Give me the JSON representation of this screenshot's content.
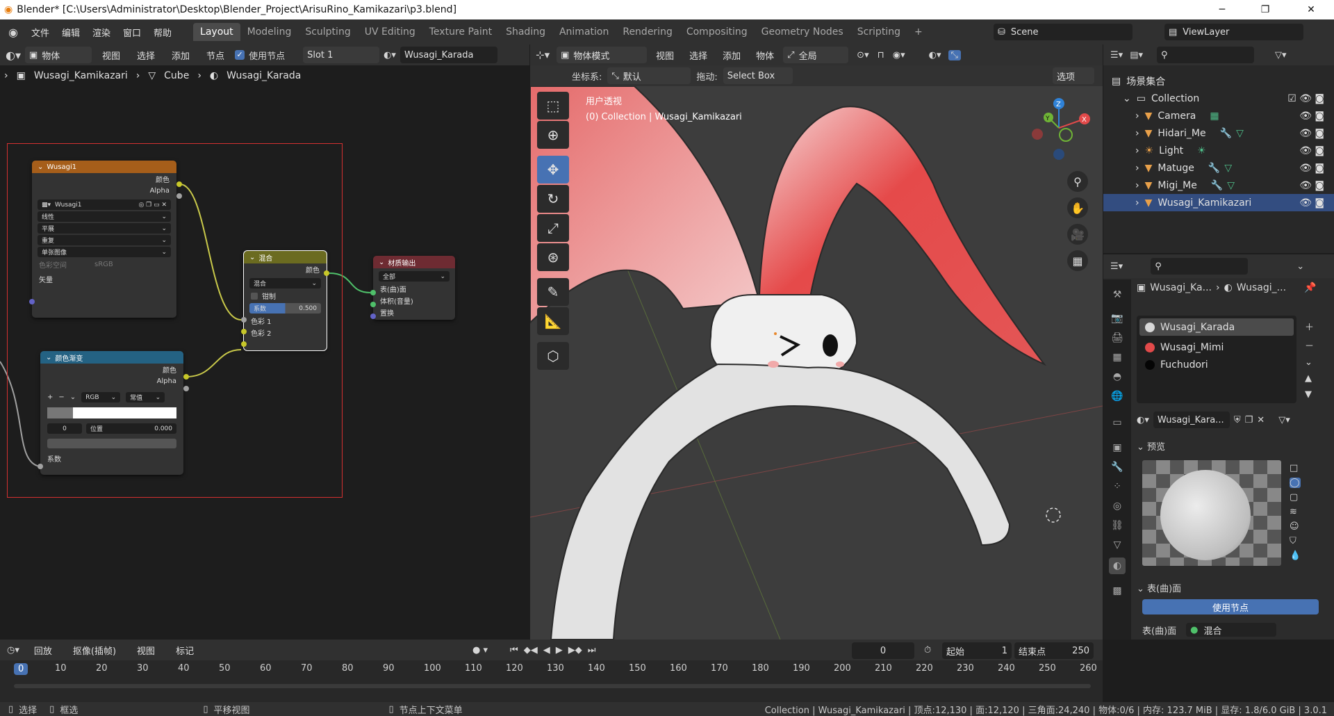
{
  "titlebar": {
    "title": "Blender* [C:\\Users\\Administrator\\Desktop\\Blender_Project\\ArisuRino_Kamikazari\\p3.blend]",
    "minimize": "─",
    "maximize": "❐",
    "close": "✕"
  },
  "menu": {
    "items": [
      "文件",
      "编辑",
      "渲染",
      "窗口",
      "帮助"
    ],
    "workspaces": [
      "Layout",
      "Modeling",
      "Sculpting",
      "UV Editing",
      "Texture Paint",
      "Shading",
      "Animation",
      "Rendering",
      "Compositing",
      "Geometry Nodes",
      "Scripting",
      "+"
    ],
    "active_workspace": "Layout",
    "scene": "Scene",
    "view_layer": "ViewLayer"
  },
  "node_editor": {
    "header": {
      "object": "物体",
      "view": "视图",
      "select": "选择",
      "add": "添加",
      "node": "节点",
      "use_nodes": "使用节点",
      "slot": "Slot 1",
      "material": "Wusagi_Karada"
    },
    "breadcrumb": [
      "Wusagi_Kamikazari",
      "Cube",
      "Wusagi_Karada"
    ],
    "nodes": {
      "image": {
        "title": "Wusagi1",
        "out_color": "颜色",
        "out_alpha": "Alpha",
        "image_name": "Wusagi1",
        "interp": "线性",
        "proj": "平展",
        "ext": "重复",
        "source": "单张图像",
        "colorspace_label": "色彩空间",
        "colorspace_value": "sRGB",
        "in_vector": "矢量"
      },
      "ramp": {
        "title": "颜色渐变",
        "out_color": "颜色",
        "out_alpha": "Alpha",
        "mode": "RGB",
        "interp": "常值",
        "index": "0",
        "pos_label": "位置",
        "pos_value": "0.000",
        "in_fac": "系数"
      },
      "mix": {
        "title": "混合",
        "out_color": "颜色",
        "blend": "混合",
        "clamp": "钳制",
        "fac_label": "系数",
        "fac_value": "0.500",
        "color1": "色彩 1",
        "color2": "色彩 2"
      },
      "output": {
        "title": "材质输出",
        "target": "全部",
        "surface": "表(曲)面",
        "volume": "体积(音量)",
        "displacement": "置换"
      }
    }
  },
  "viewport": {
    "mode": "物体模式",
    "menus": [
      "视图",
      "选择",
      "添加",
      "物体"
    ],
    "transform": "全局",
    "coord_label": "坐标系:",
    "coord_value": "默认",
    "drag_label": "拖动:",
    "drag_value": "Select Box",
    "options": "选项",
    "overlay_title": "用户透视",
    "overlay_sub": "(0) Collection | Wusagi_Kamikazari",
    "gizmo": {
      "x": "X",
      "y": "Y",
      "z": "Z"
    }
  },
  "outliner": {
    "root": "场景集合",
    "collection": "Collection",
    "items": [
      "Camera",
      "Hidari_Me",
      "Light",
      "Matuge",
      "Migi_Me",
      "Wusagi_Kamikazari"
    ]
  },
  "properties": {
    "breadcrumb_obj": "Wusagi_Ka...",
    "breadcrumb_mat": "Wusagi_...",
    "slots": [
      "Wusagi_Karada",
      "Wusagi_Mimi",
      "Fuchudori"
    ],
    "slot_colors": [
      "#d8d8d8",
      "#e24a4a",
      "#050505"
    ],
    "material_field": "Wusagi_Kara...",
    "preview_label": "预览",
    "surface_label": "表(曲)面",
    "use_nodes_btn": "使用节点",
    "surface_row_label": "表(曲)面",
    "surface_row_value": "混合"
  },
  "timeline": {
    "playback": "回放",
    "keying": "抠像(插帧)",
    "view": "视图",
    "marker": "标记",
    "current_frame": "0",
    "start_label": "起始",
    "start_value": "1",
    "end_label": "结束点",
    "end_value": "250",
    "ruler": [
      "0",
      "10",
      "20",
      "30",
      "40",
      "50",
      "60",
      "70",
      "80",
      "90",
      "100",
      "110",
      "120",
      "130",
      "140",
      "150",
      "160",
      "170",
      "180",
      "190",
      "200",
      "210",
      "220",
      "230",
      "240",
      "250",
      "260"
    ]
  },
  "statusbar": {
    "select": "选择",
    "box_select": "框选",
    "pan": "平移视图",
    "context": "节点上下文菜单",
    "stats": "Collection | Wusagi_Kamikazari | 顶点:12,130 | 面:12,120 | 三角面:24,240 | 物体:0/6 | 内存: 123.7 MiB | 显存: 1.8/6.0 GiB | 3.0.1"
  }
}
